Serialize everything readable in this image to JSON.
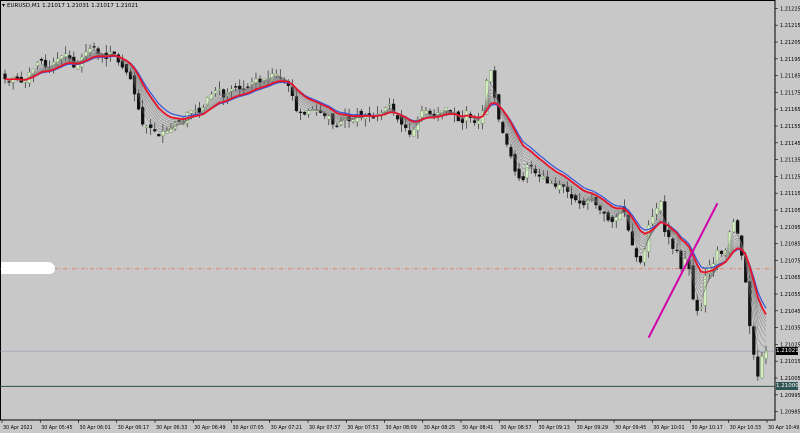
{
  "title_bar": {
    "symbol": "EURUSD,M1",
    "ohlc": "1.21017 1.21031 1.21017 1.21021"
  },
  "price_scale": [
    "1.21225",
    "1.21215",
    "1.21205",
    "1.21195",
    "1.21185",
    "1.21175",
    "1.21165",
    "1.21155",
    "1.21145",
    "1.21135",
    "1.21125",
    "1.21115",
    "1.21105",
    "1.21095",
    "1.21085",
    "1.21075",
    "1.21065",
    "1.21055",
    "1.21045",
    "1.21035",
    "1.21025",
    "1.21015",
    "1.21005",
    "1.20995",
    "1.20985"
  ],
  "time_scale": [
    "30 Apr 2021",
    "30 Apr 05:45",
    "30 Apr 06:01",
    "30 Apr 06:17",
    "30 Apr 06:33",
    "30 Apr 06:49",
    "30 Apr 07:05",
    "30 Apr 07:21",
    "30 Apr 07:37",
    "30 Apr 07:53",
    "30 Apr 08:09",
    "30 Apr 08:25",
    "30 Apr 08:41",
    "30 Apr 08:57",
    "30 Apr 09:13",
    "30 Apr 09:29",
    "30 Apr 09:45",
    "30 Apr 10:01",
    "30 Apr 10:17",
    "30 Apr 10:33",
    "30 Apr 10:49"
  ],
  "price_tags": [
    {
      "label": "1.21021",
      "price": 1.21021,
      "color": "#000000"
    },
    {
      "label": "1.21000",
      "price": 1.21,
      "color": "#2f5252"
    }
  ],
  "colors": {
    "background": "#c8c8c8",
    "bull_candle": "#d6f0c4",
    "bear_candle": "#111111",
    "ema_fast": "#e8142a",
    "ema_slow": "#3455d8",
    "trendline": "#d000a8",
    "level_line": "#e06030"
  },
  "chart_data": {
    "type": "candlestick",
    "symbol": "EURUSD",
    "timeframe": "M1",
    "ylim": [
      1.2098,
      1.2123
    ],
    "reference_levels": [
      1.2107,
      1.21021,
      1.21
    ],
    "series": {
      "close": [
        1.21183,
        1.21181,
        1.21184,
        1.21183,
        1.21181,
        1.21182,
        1.21187,
        1.21189,
        1.21193,
        1.21194,
        1.2119,
        1.21189,
        1.21193,
        1.21195,
        1.21197,
        1.21198,
        1.21195,
        1.2119,
        1.21192,
        1.21196,
        1.21199,
        1.21201,
        1.21202,
        1.21198,
        1.21197,
        1.21195,
        1.21199,
        1.21198,
        1.21193,
        1.2119,
        1.21187,
        1.21183,
        1.21174,
        1.21165,
        1.21156,
        1.21155,
        1.21154,
        1.21152,
        1.21149,
        1.21152,
        1.21152,
        1.21154,
        1.21157,
        1.21158,
        1.21157,
        1.21163,
        1.21164,
        1.21164,
        1.21163,
        1.21166,
        1.21172,
        1.21174,
        1.21176,
        1.21177,
        1.21172,
        1.21175,
        1.21177,
        1.21178,
        1.21177,
        1.21177,
        1.21178,
        1.21181,
        1.21183,
        1.21181,
        1.21183,
        1.21183,
        1.21186,
        1.21186,
        1.21184,
        1.21181,
        1.21179,
        1.21173,
        1.21164,
        1.21163,
        1.21162,
        1.21164,
        1.21165,
        1.21164,
        1.21163,
        1.21161,
        1.21161,
        1.21156,
        1.21155,
        1.21158,
        1.21161,
        1.21158,
        1.21159,
        1.21162,
        1.2116,
        1.21162,
        1.21161,
        1.2116,
        1.21162,
        1.21163,
        1.21166,
        1.21168,
        1.21163,
        1.21159,
        1.21156,
        1.21154,
        1.2115,
        1.21153,
        1.21159,
        1.21164,
        1.21164,
        1.21162,
        1.2116,
        1.21163,
        1.21164,
        1.21166,
        1.21163,
        1.21162,
        1.21158,
        1.21157,
        1.21164,
        1.2116,
        1.21157,
        1.21158,
        1.21164,
        1.21182,
        1.21188,
        1.21172,
        1.21159,
        1.21151,
        1.21144,
        1.21137,
        1.21128,
        1.21124,
        1.21123,
        1.21132,
        1.21131,
        1.21127,
        1.21125,
        1.21125,
        1.21121,
        1.21121,
        1.21119,
        1.2112,
        1.21119,
        1.21116,
        1.21112,
        1.21111,
        1.21109,
        1.21108,
        1.21111,
        1.21112,
        1.21108,
        1.21105,
        1.21103,
        1.21099,
        1.21098,
        1.21101,
        1.21106,
        1.21104,
        1.21093,
        1.21084,
        1.21077,
        1.21074,
        1.21082,
        1.21096,
        1.21101,
        1.21106,
        1.2111,
        1.21092,
        1.21089,
        1.21082,
        1.21081,
        1.2107,
        1.21076,
        1.2107,
        1.21052,
        1.21045,
        1.21047,
        1.21066,
        1.21072,
        1.21073,
        1.21081,
        1.21079,
        1.21081,
        1.21092,
        1.21098,
        1.21091,
        1.21078,
        1.21062,
        1.21036,
        1.21019,
        1.21006,
        1.21018,
        1.21021
      ]
    }
  }
}
